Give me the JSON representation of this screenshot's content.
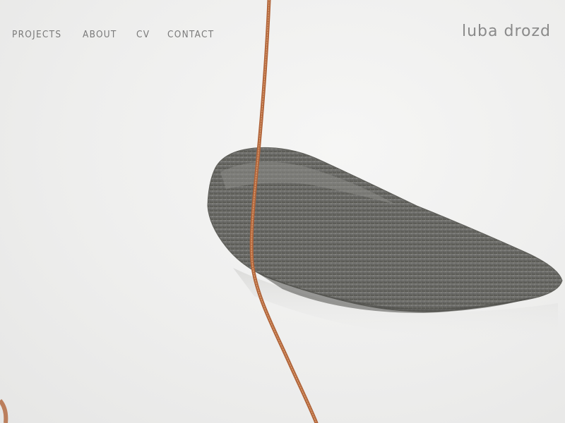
{
  "site": {
    "name": "luba drozd"
  },
  "nav": {
    "items": [
      {
        "label": "PROJECTS"
      },
      {
        "label": "ABOUT"
      },
      {
        "label": "CV"
      },
      {
        "label": "CONTACT"
      }
    ]
  },
  "colors": {
    "nav_text": "#7a7a7a",
    "brand_text": "#8a8a8a",
    "background": "#f1f1f0"
  }
}
